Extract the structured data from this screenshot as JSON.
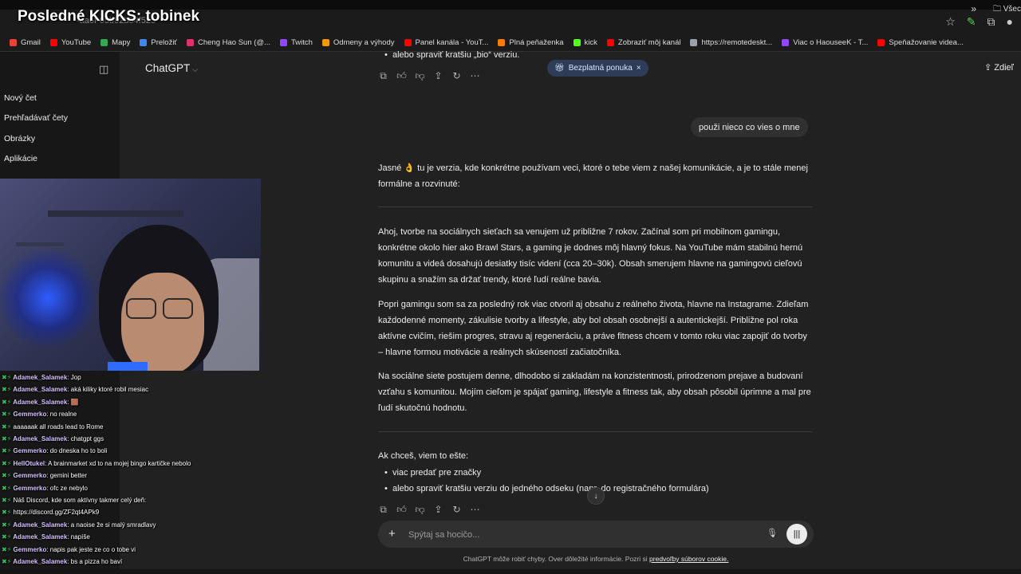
{
  "browser": {
    "url_fragment": "-aa6f-05b92b54f525",
    "bookmarks": [
      {
        "label": "Gmail",
        "color": "#ea4335"
      },
      {
        "label": "YouTube",
        "color": "#ff0000"
      },
      {
        "label": "Mapy",
        "color": "#34a853"
      },
      {
        "label": "Preložiť",
        "color": "#4285f4"
      },
      {
        "label": "Cheng Hao Sun (@...",
        "color": "#e1306c"
      },
      {
        "label": "Twitch",
        "color": "#9146ff"
      },
      {
        "label": "Odmeny a výhody",
        "color": "#f29900"
      },
      {
        "label": "Panel kanála - YouT...",
        "color": "#ff0000"
      },
      {
        "label": "Plná peňaženka",
        "color": "#f57c00"
      },
      {
        "label": "kick",
        "color": "#53fc18"
      },
      {
        "label": "Zobraziť môj kanál",
        "color": "#ff0000"
      },
      {
        "label": "https://remotedeskt...",
        "color": "#9aa0a6"
      },
      {
        "label": "Viac o HaouseeK - T...",
        "color": "#9146ff"
      },
      {
        "label": "Speňažovanie videa...",
        "color": "#ff0000"
      }
    ],
    "bookmarks_more": "»",
    "bookmarks_folder": "Všec"
  },
  "stream": {
    "title": "Posledné KICKS: tobinek"
  },
  "sidebar": {
    "items": [
      {
        "label": "Nový čet"
      },
      {
        "label": "Prehľadávať čety"
      },
      {
        "label": "Obrázky"
      },
      {
        "label": "Aplikácie"
      }
    ]
  },
  "header": {
    "model": "ChatGPT",
    "share": "Zdieľ"
  },
  "offer_badge": {
    "label": "Bezplatná ponuka",
    "close": "×"
  },
  "conversation": {
    "top_bullet": "alebo spraviť kratšiu „bio“ verziu.",
    "user_message": "použi nieco co vies o mne",
    "intro": "Jasné 👌 tu je verzia, kde konkrétne používam veci, ktoré o tebe viem z našej komunikácie, a je to stále menej formálne a rozvinuté:",
    "para1": "Ahoj, tvorbe na sociálnych sieťach sa venujem už približne 7 rokov. Začínal som pri mobilnom gamingu, konkrétne okolo hier ako Brawl Stars, a gaming je dodnes môj hlavný fokus. Na YouTube mám stabilnú hernú komunitu a videá dosahujú desiatky tisíc videní (cca 20–30k). Obsah smerujem hlavne na gamingovú cieľovú skupinu a snažím sa držať trendy, ktoré ľudí reálne bavia.",
    "para2": "Popri gamingu som sa za posledný rok viac otvoril aj obsahu z reálneho života, hlavne na Instagrame. Zdieľam každodenné momenty, zákulisie tvorby a lifestyle, aby bol obsah osobnejší a autentickejší. Približne pol roka aktívne cvičím, riešim progres, stravu aj regeneráciu, a práve fitness chcem v tomto roku viac zapojiť do tvorby – hlavne formou motivácie a reálnych skúseností začiatočníka.",
    "para3": "Na sociálne siete postujem denne, dlhodobo si zakladám na konzistentnosti, prirodzenom prejave a budovaní vzťahu s komunitou. Mojím cieľom je spájať gaming, lifestyle a fitness tak, aby obsah pôsobil úprimne a mal pre ľudí skutočnú hodnotu.",
    "ask": "Ak chceš, viem to ešte:",
    "bullets": [
      "viac predať pre značky",
      "alebo spraviť kratšiu verziu do jedného odseku (napr. do registračného formulára)"
    ]
  },
  "composer": {
    "placeholder": "Spýtaj sa hocičo...",
    "footer": "ChatGPT môže robiť chyby. Over dôležité informácie. Pozri si",
    "footer_link": "predvoľby súborov cookie."
  },
  "chat_overlay": [
    {
      "user": "Adamek_Salamek",
      "text": ": Jop"
    },
    {
      "user": "Adamek_Salamek",
      "text": ": aká kiliky ktoré robil mesiac"
    },
    {
      "user": "Adamek_Salamek",
      "text": ": 🟫"
    },
    {
      "user": "Gemmerko",
      "text": ": no realne"
    },
    {
      "user": "",
      "text": "aaaaaak all roads lead to Rome"
    },
    {
      "user": "Adamek_Salamek",
      "text": ": chatgpt ggs"
    },
    {
      "user": "Gemmerko",
      "text": ": do dneska ho to boli"
    },
    {
      "user": "HellOtukel",
      "text": ": A brainmarket xd to na mojej bingo kartičke nebolo"
    },
    {
      "user": "Gemmerko",
      "text": ": gemini better"
    },
    {
      "user": "Gemmerko",
      "text": ": ofc ze nebylo"
    },
    {
      "user": "",
      "text": "Náš Discord, kde som aktívny takmer celý deň:"
    },
    {
      "user": "",
      "text": "https://discord.gg/ZF2qt4APk9"
    },
    {
      "user": "Adamek_Salamek",
      "text": ": a naoise že si malý smradlavy"
    },
    {
      "user": "Adamek_Salamek",
      "text": ": napíše"
    },
    {
      "user": "Gemmerko",
      "text": ": napis pak jeste ze co o tobe vi"
    },
    {
      "user": "Adamek_Salamek",
      "text": ": bs a pizza ho baví"
    }
  ],
  "colors": {
    "background": "#212121",
    "sidebar": "#171717",
    "offer_badge": "#2f3c57"
  }
}
